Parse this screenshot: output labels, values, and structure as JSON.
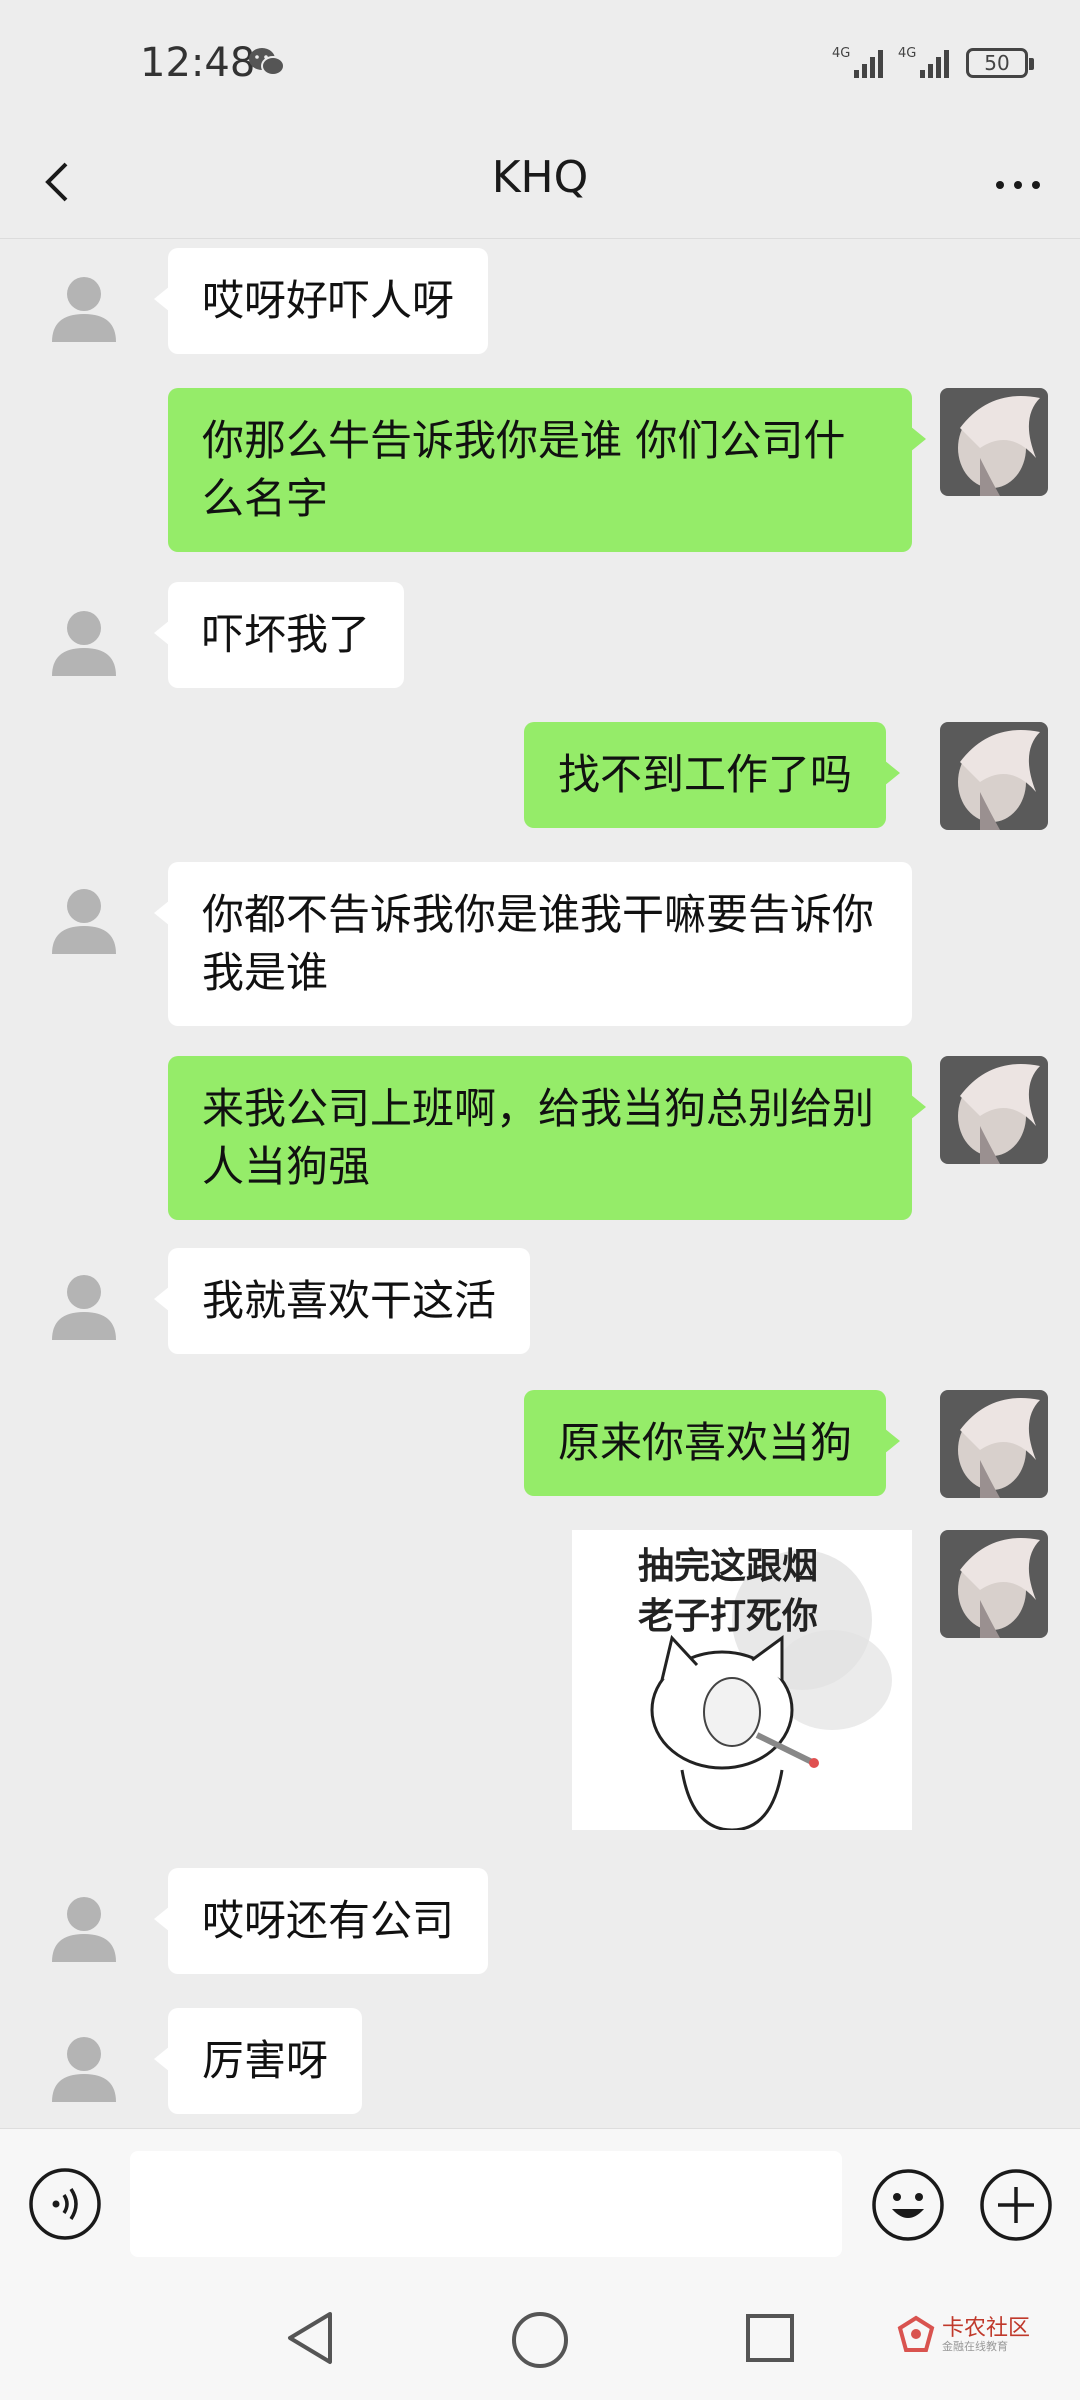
{
  "status_bar": {
    "time": "12:48",
    "network_1": "4G",
    "network_2": "4G",
    "battery": "50"
  },
  "header": {
    "title": "KHQ",
    "back_icon": "chevron-left-icon",
    "more_icon": "more-dots-icon"
  },
  "messages": [
    {
      "from": "other",
      "text": "哎呀好吓人呀"
    },
    {
      "from": "self",
      "text": "你那么牛告诉我你是谁 你们公司什么名字"
    },
    {
      "from": "other",
      "text": "吓坏我了"
    },
    {
      "from": "self",
      "text": "找不到工作了吗"
    },
    {
      "from": "other",
      "text": "你都不告诉我你是谁我干嘛要告诉你我是谁"
    },
    {
      "from": "self",
      "text": "来我公司上班啊，给我当狗总别给别人当狗强"
    },
    {
      "from": "other",
      "text": "我就喜欢干这活"
    },
    {
      "from": "self",
      "text": "原来你喜欢当狗"
    },
    {
      "from": "self",
      "type": "sticker",
      "text": "抽完这跟烟\n老子打死你"
    },
    {
      "from": "other",
      "text": "哎呀还有公司"
    },
    {
      "from": "other",
      "text": "厉害呀"
    }
  ],
  "input_bar": {
    "placeholder": "",
    "value": "",
    "voice_icon": "voice-icon",
    "emoji_icon": "emoji-icon",
    "plus_icon": "plus-icon"
  },
  "nav_bar": {
    "back_icon": "triangle-back-icon",
    "home_icon": "circle-home-icon",
    "recent_icon": "square-recent-icon"
  },
  "watermark": {
    "title": "卡农社区",
    "subtitle": "金融在线教育"
  },
  "colors": {
    "background": "#ededed",
    "outgoing_bubble": "#95ec69",
    "incoming_bubble": "#ffffff"
  }
}
